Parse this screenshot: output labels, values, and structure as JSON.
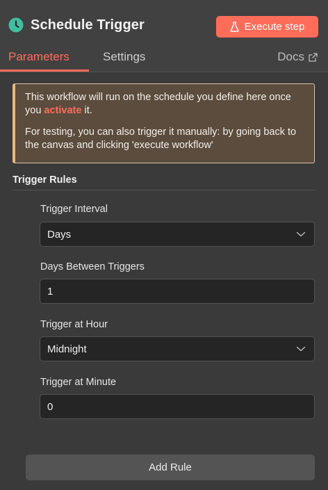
{
  "header": {
    "title": "Schedule Trigger",
    "node_icon": "clock-icon",
    "execute_button": "Execute step",
    "execute_icon": "flask-icon"
  },
  "tabs": [
    {
      "label": "Parameters",
      "active": true
    },
    {
      "label": "Settings",
      "active": false
    }
  ],
  "docs": {
    "label": "Docs",
    "icon": "external-link-icon"
  },
  "notice": {
    "line1_prefix": "This workflow will run on the schedule you define here once you ",
    "line1_link": "activate",
    "line1_suffix": " it.",
    "line2": "For testing, you can also trigger it manually: by going back to the canvas and clicking 'execute workflow'"
  },
  "trigger_rules": {
    "title": "Trigger Rules",
    "fields": [
      {
        "label": "Trigger Interval",
        "value": "Days",
        "type": "select"
      },
      {
        "label": "Days Between Triggers",
        "value": "1",
        "type": "input"
      },
      {
        "label": "Trigger at Hour",
        "value": "Midnight",
        "type": "select"
      },
      {
        "label": "Trigger at Minute",
        "value": "0",
        "type": "input"
      }
    ],
    "add_rule_label": "Add Rule"
  },
  "colors": {
    "accent": "#ff6d5a",
    "clock_icon": "#3fbf9f",
    "notice_bg": "#5b4c3e",
    "notice_border": "#f0b775"
  }
}
